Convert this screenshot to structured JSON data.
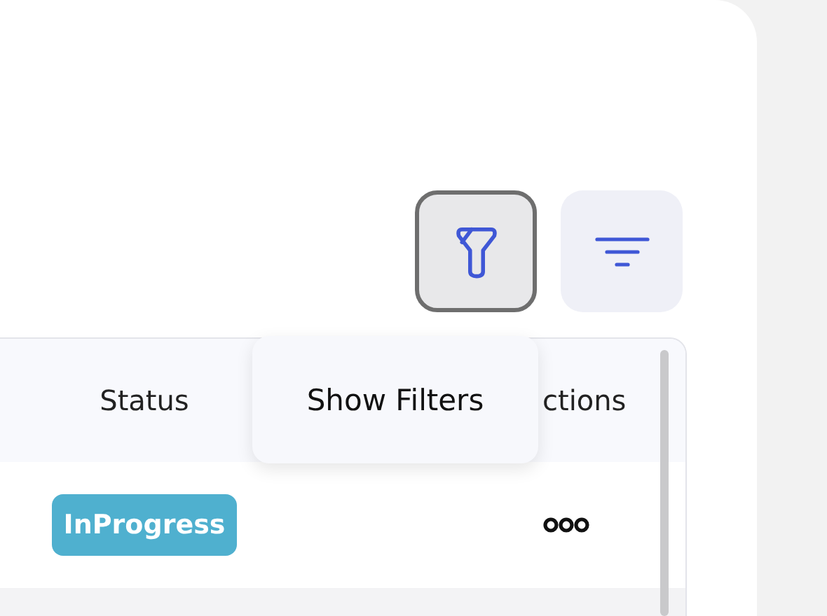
{
  "toolbar": {
    "buttons": [
      {
        "kind": "funnel",
        "focused": true
      },
      {
        "kind": "lines",
        "focused": false
      }
    ]
  },
  "tooltip": {
    "text": "Show Filters"
  },
  "table": {
    "columns": [
      "Status",
      "ctions"
    ],
    "rows": [
      {
        "status": {
          "text": "InProgress",
          "color": "#4fb0cf"
        },
        "actions": {
          "kind": "more"
        }
      }
    ]
  }
}
